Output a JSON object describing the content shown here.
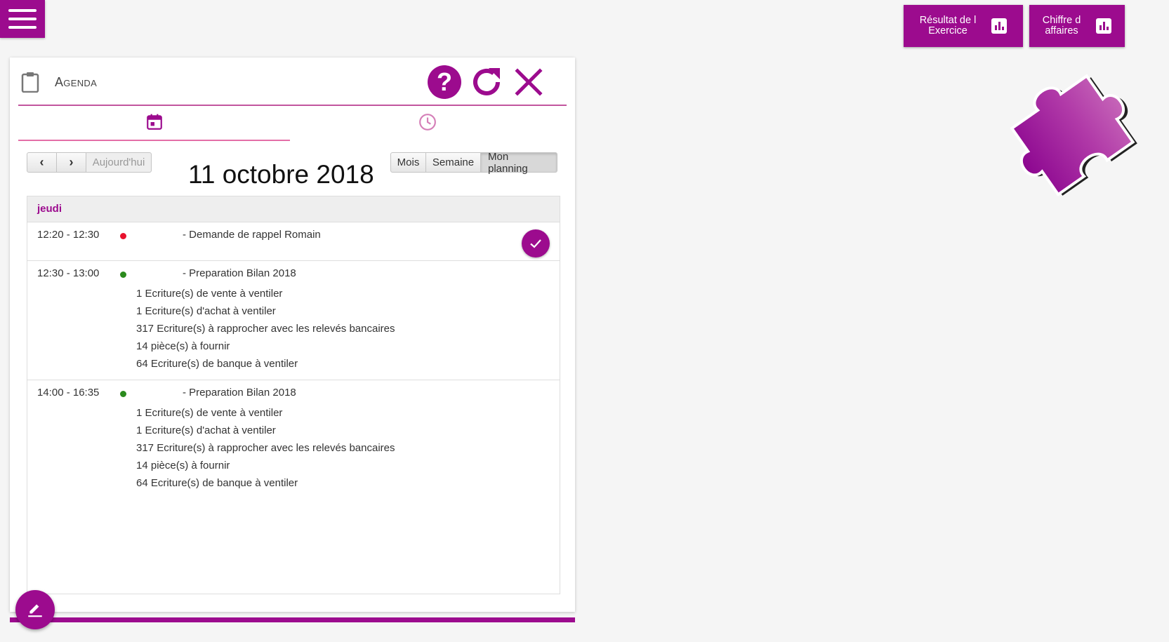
{
  "colors": {
    "accent": "#9c0b8e",
    "tab_underline": "#e46fa7",
    "dot_red": "#e8112d",
    "dot_green": "#2a8a1d"
  },
  "menu": {
    "icon": "hamburger-icon"
  },
  "kpi": [
    {
      "label_line1": "Résultat de l",
      "label_line2": "Exercice",
      "icon": "bar-chart-icon"
    },
    {
      "label_line1": "Chiffre d",
      "label_line2": "affaires",
      "icon": "bar-chart-icon"
    }
  ],
  "decor": {
    "icon": "puzzle-piece-icon"
  },
  "agenda": {
    "title": "Agenda",
    "header_icons": [
      "clipboard-icon",
      "help-icon",
      "refresh-icon",
      "close-icon"
    ],
    "tabs": [
      {
        "icon": "calendar-icon",
        "active": true
      },
      {
        "icon": "clock-icon",
        "active": false
      }
    ],
    "nav": {
      "prev": "‹",
      "next": "›",
      "today": "Aujourd'hui"
    },
    "date_title": "11 octobre 2018",
    "views": [
      {
        "label": "Mois",
        "active": false
      },
      {
        "label": "Semaine",
        "active": false
      },
      {
        "label": "Mon planning",
        "active": true
      }
    ],
    "day_label": "jeudi",
    "events": [
      {
        "time": "12:20 - 12:30",
        "dot": "red",
        "title": "- Demande de rappel Romain",
        "lines": [],
        "done_button": true
      },
      {
        "time": "12:30 - 13:00",
        "dot": "green",
        "title": "- Preparation Bilan 2018",
        "lines": [
          "1 Ecriture(s) de vente à ventiler",
          "1 Ecriture(s) d'achat à ventiler",
          "317 Ecriture(s) à rapprocher avec les relevés bancaires",
          "14 pièce(s) à fournir",
          "64 Ecriture(s) de banque à ventiler"
        ]
      },
      {
        "time": "14:00 - 16:35",
        "dot": "green",
        "title": "- Preparation Bilan 2018",
        "lines": [
          "1 Ecriture(s) de vente à ventiler",
          "1 Ecriture(s) d'achat à ventiler",
          "317 Ecriture(s) à rapprocher avec les relevés bancaires",
          "14 pièce(s) à fournir",
          "64 Ecriture(s) de banque à ventiler"
        ]
      }
    ]
  },
  "fab": {
    "icon": "pencil-icon"
  }
}
